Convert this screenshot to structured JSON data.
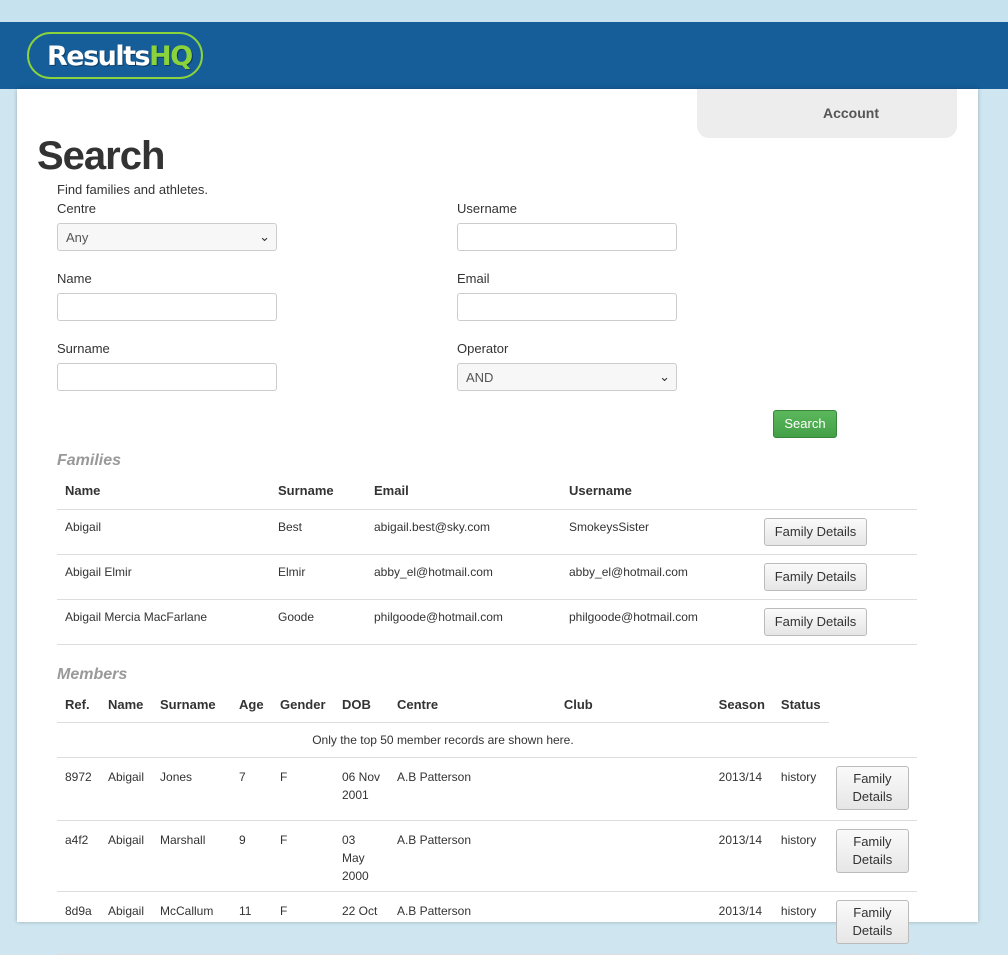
{
  "brand": {
    "logo_main": "Results",
    "logo_accent": "HQ"
  },
  "nav": {
    "account": "Account"
  },
  "page": {
    "title": "Search",
    "subtitle": "Find families and athletes."
  },
  "form": {
    "centre_label": "Centre",
    "centre_value": "Any",
    "username_label": "Username",
    "username_value": "",
    "name_label": "Name",
    "name_value": "",
    "email_label": "Email",
    "email_value": "",
    "surname_label": "Surname",
    "surname_value": "",
    "operator_label": "Operator",
    "operator_value": "AND",
    "search_button": "Search"
  },
  "families": {
    "title": "Families",
    "columns": [
      "Name",
      "Surname",
      "Email",
      "Username"
    ],
    "rows": [
      {
        "name": "Abigail",
        "surname": "Best",
        "email": "abigail.best@sky.com",
        "username": "SmokeysSister",
        "action": "Family Details"
      },
      {
        "name": "Abigail Elmir",
        "surname": "Elmir",
        "email": "abby_el@hotmail.com",
        "username": "abby_el@hotmail.com",
        "action": "Family Details"
      },
      {
        "name": "Abigail Mercia MacFarlane",
        "surname": "Goode",
        "email": "philgoode@hotmail.com",
        "username": "philgoode@hotmail.com",
        "action": "Family Details"
      }
    ]
  },
  "members": {
    "title": "Members",
    "columns": [
      "Ref.",
      "Name",
      "Surname",
      "Age",
      "Gender",
      "DOB",
      "Centre",
      "Club",
      "Season",
      "Status"
    ],
    "note": "Only the top 50 member records are shown here.",
    "rows": [
      {
        "ref": "8972",
        "name": "Abigail",
        "surname": "Jones",
        "age": "7",
        "gender": "F",
        "dob": "06 Nov 2001",
        "centre": "A.B Patterson",
        "club": "",
        "season": "2013/14",
        "status": "history",
        "action": "Family Details"
      },
      {
        "ref": "a4f2",
        "name": "Abigail",
        "surname": "Marshall",
        "age": "9",
        "gender": "F",
        "dob": "03 May 2000",
        "centre": "A.B Patterson",
        "club": "",
        "season": "2013/14",
        "status": "history",
        "action": "Family Details"
      },
      {
        "ref": "8d9a",
        "name": "Abigail",
        "surname": "McCallum",
        "age": "11",
        "gender": "F",
        "dob": "22 Oct",
        "centre": "A.B Patterson",
        "club": "",
        "season": "2013/14",
        "status": "history",
        "action": "Family Details"
      }
    ]
  }
}
